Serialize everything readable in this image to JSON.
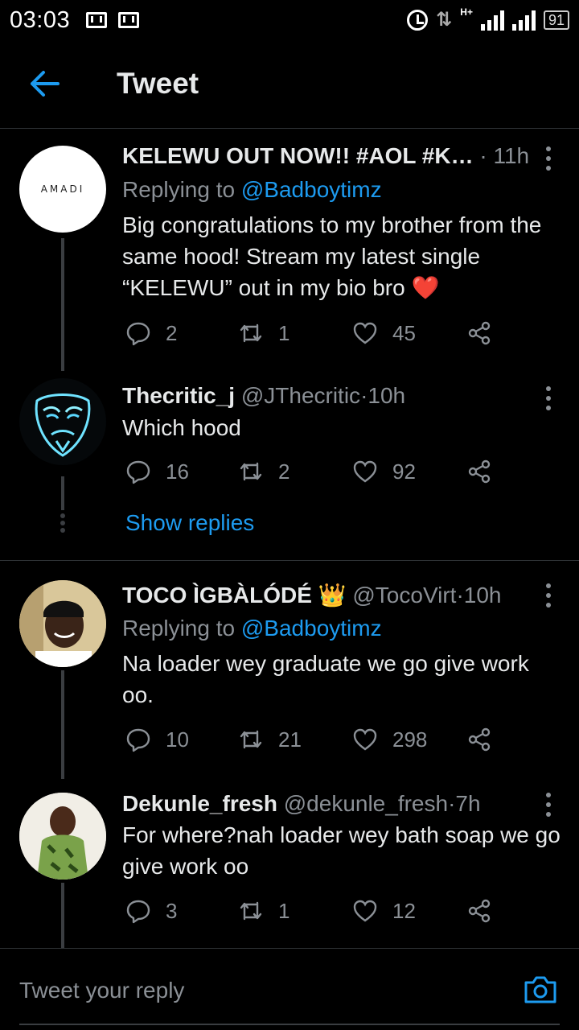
{
  "status_bar": {
    "time": "03:03",
    "battery": "91",
    "network": "H+"
  },
  "header": {
    "title": "Tweet"
  },
  "tweets": [
    {
      "name": "KELEWU OUT NOW!! #AOL #K…",
      "handle": "",
      "dot": "·",
      "age": "11h",
      "replying_label": "Replying to ",
      "replying_to": "@Badboytimz",
      "text": "Big congratulations to my brother from the same hood! Stream my latest single “KELEWU” out in my bio bro ",
      "emoji": "❤️",
      "avatar_text": "AMADI",
      "replies": "2",
      "retweets": "1",
      "likes": "45"
    },
    {
      "name": "Thecritic_j",
      "handle": "@JThecritic",
      "dot": "·",
      "age": "10h",
      "text": "Which hood",
      "replies": "16",
      "retweets": "2",
      "likes": "92",
      "show_replies": "Show replies"
    },
    {
      "name": "TOCO ÌGBÀLÓDÉ",
      "emoji": "👑",
      "handle": "@TocoVirt",
      "dot": "·",
      "age": "10h",
      "replying_label": "Replying to ",
      "replying_to": "@Badboytimz",
      "text": "Na loader wey graduate we go give work oo.",
      "replies": "10",
      "retweets": "21",
      "likes": "298"
    },
    {
      "name": "Dekunle_fresh",
      "handle": "@dekunle_fresh",
      "dot": "·",
      "age": "7h",
      "text": "For where?nah loader wey bath soap we go give work oo",
      "replies": "3",
      "retweets": "1",
      "likes": "12"
    }
  ],
  "reply_bar": {
    "placeholder": "Tweet your reply"
  },
  "colors": {
    "background": "#000000",
    "accent": "#1d9bf0",
    "muted": "#8b9096",
    "text": "#e7e9ea",
    "divider": "#2f3336"
  }
}
